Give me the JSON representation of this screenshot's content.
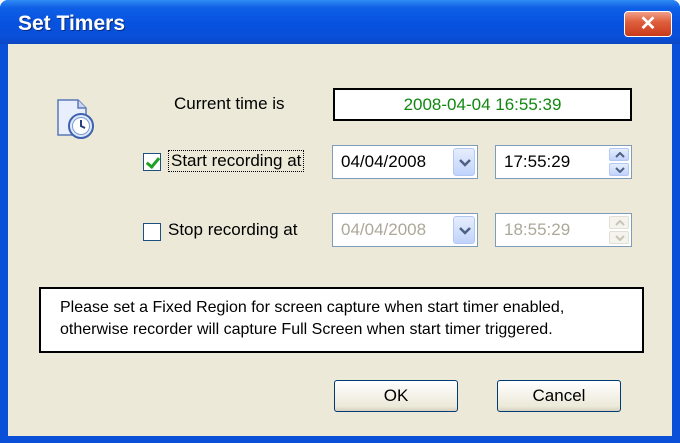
{
  "window": {
    "title": "Set Timers",
    "close_glyph": "✕"
  },
  "current_time": {
    "label": "Current time is",
    "value": "2008-04-04  16:55:39",
    "value_color": "#118811"
  },
  "start": {
    "checked": true,
    "label": "Start recording at",
    "date": "04/04/2008",
    "time": "17:55:29"
  },
  "stop": {
    "checked": false,
    "label": "Stop recording at",
    "date": "04/04/2008",
    "time": "18:55:29"
  },
  "note": {
    "line1": "Please set a Fixed Region for screen capture when start timer enabled,",
    "line2": "otherwise recorder will capture Full Screen when start timer triggered."
  },
  "buttons": {
    "ok": "OK",
    "cancel": "Cancel"
  },
  "icons": {
    "timer": "clock-document-icon",
    "dropdown": "chevron-down-icon",
    "spin": "spin-arrows-icon"
  }
}
